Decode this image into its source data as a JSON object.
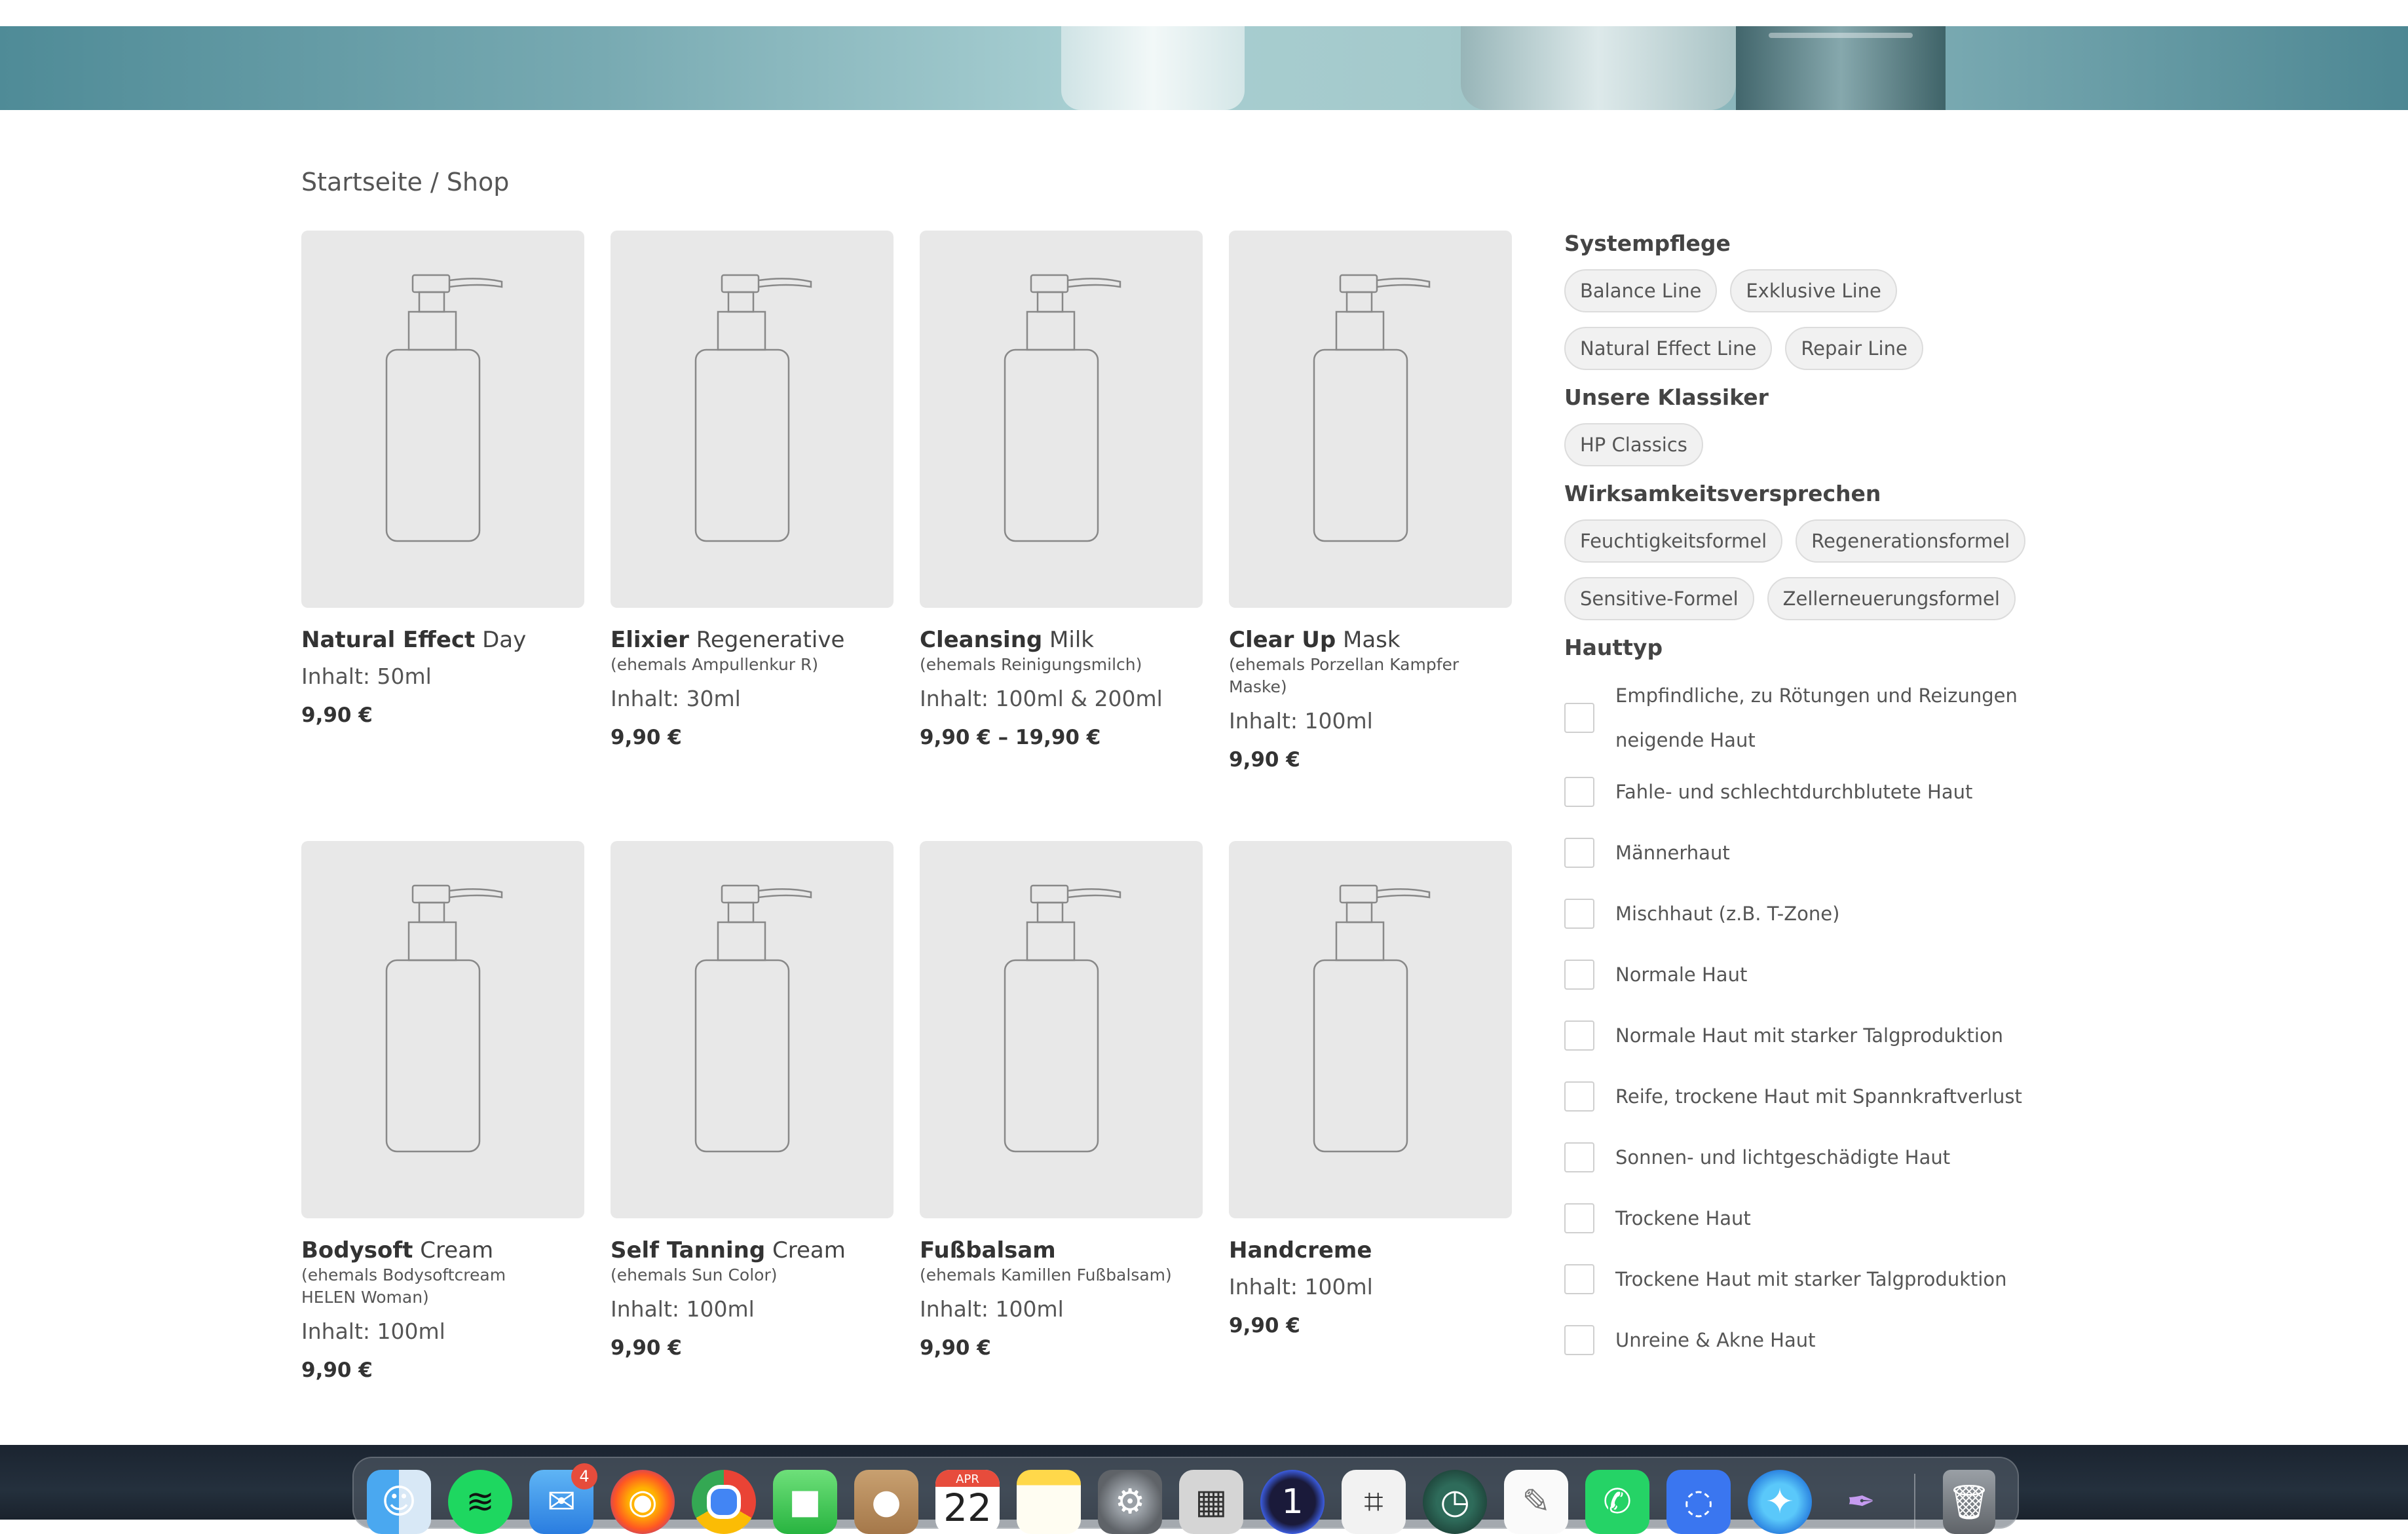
{
  "breadcrumb": "Startseite / Shop",
  "products": [
    {
      "title_bold": "Natural Effect",
      "title_rest": " Day",
      "subtitle": "",
      "content": "Inhalt: 50ml",
      "price": "9,90 €"
    },
    {
      "title_bold": "Elixier",
      "title_rest": " Regenerative",
      "subtitle": "(ehemals Ampullenkur R)",
      "content": "Inhalt: 30ml",
      "price": "9,90 €"
    },
    {
      "title_bold": "Cleansing",
      "title_rest": " Milk",
      "subtitle": "(ehemals Reinigungsmilch)",
      "content": "Inhalt: 100ml & 200ml",
      "price": "9,90 € – 19,90 €"
    },
    {
      "title_bold": "Clear Up",
      "title_rest": " Mask",
      "subtitle": "(ehemals Porzellan Kampfer Maske)",
      "content": "Inhalt: 100ml",
      "price": "9,90 €"
    },
    {
      "title_bold": "Bodysoft",
      "title_rest": " Cream",
      "subtitle": "(ehemals Bodysoftcream HELEN Woman)",
      "content": "Inhalt: 100ml",
      "price": "9,90 €"
    },
    {
      "title_bold": "Self Tanning",
      "title_rest": " Cream",
      "subtitle": "(ehemals Sun Color)",
      "content": "Inhalt: 100ml",
      "price": "9,90 €"
    },
    {
      "title_bold": "Fußbalsam",
      "title_rest": "",
      "subtitle": "(ehemals Kamillen Fußbalsam)",
      "content": "Inhalt: 100ml",
      "price": "9,90 €"
    },
    {
      "title_bold": "Handcreme",
      "title_rest": "",
      "subtitle": "",
      "content": "Inhalt: 100ml",
      "price": "9,90 €"
    }
  ],
  "sidebar": {
    "systempflege": {
      "heading": "Systempflege",
      "tags": [
        "Balance Line",
        "Exklusive Line",
        "Natural Effect Line",
        "Repair Line"
      ]
    },
    "klassiker": {
      "heading": "Unsere Klassiker",
      "tags": [
        "HP Classics"
      ]
    },
    "wirksamkeit": {
      "heading": "Wirksamkeitsversprechen",
      "tags": [
        "Feuchtigkeitsformel",
        "Regenerationsformel",
        "Sensitive-Formel",
        "Zellerneuerungsformel"
      ]
    },
    "hauttyp": {
      "heading": "Hauttyp",
      "options": [
        "Empfindliche, zu Rötungen und Reizungen neigende Haut",
        "Fahle- und schlechtdurchblutete Haut",
        "Männerhaut",
        "Mischhaut (z.B. T-Zone)",
        "Normale Haut",
        "Normale Haut mit starker Talgproduktion",
        "Reife, trockene Haut mit Spannkraftverlust",
        "Sonnen- und lichtgeschädigte Haut",
        "Trockene Haut",
        "Trockene Haut mit starker Talgproduktion",
        "Unreine & Akne Haut"
      ]
    }
  },
  "dock": {
    "mail_badge": "4",
    "calendar_month": "APR",
    "calendar_day": "22",
    "icons": [
      "finder-icon",
      "spotify-icon",
      "mail-icon",
      "firefox-icon",
      "chrome-icon",
      "facetime-icon",
      "contacts-icon",
      "calendar-icon",
      "notes-icon",
      "system-preferences-icon",
      "calculator-icon",
      "onepassword-icon",
      "screenshot-icon",
      "time-machine-icon",
      "textedit-icon",
      "whatsapp-icon",
      "signal-icon",
      "safari-icon",
      "quill-icon",
      "trash-icon"
    ]
  },
  "colors": {
    "card_bg": "#e8e8e8",
    "tag_bg": "#f1f1f1",
    "hero": "#78aab2"
  }
}
